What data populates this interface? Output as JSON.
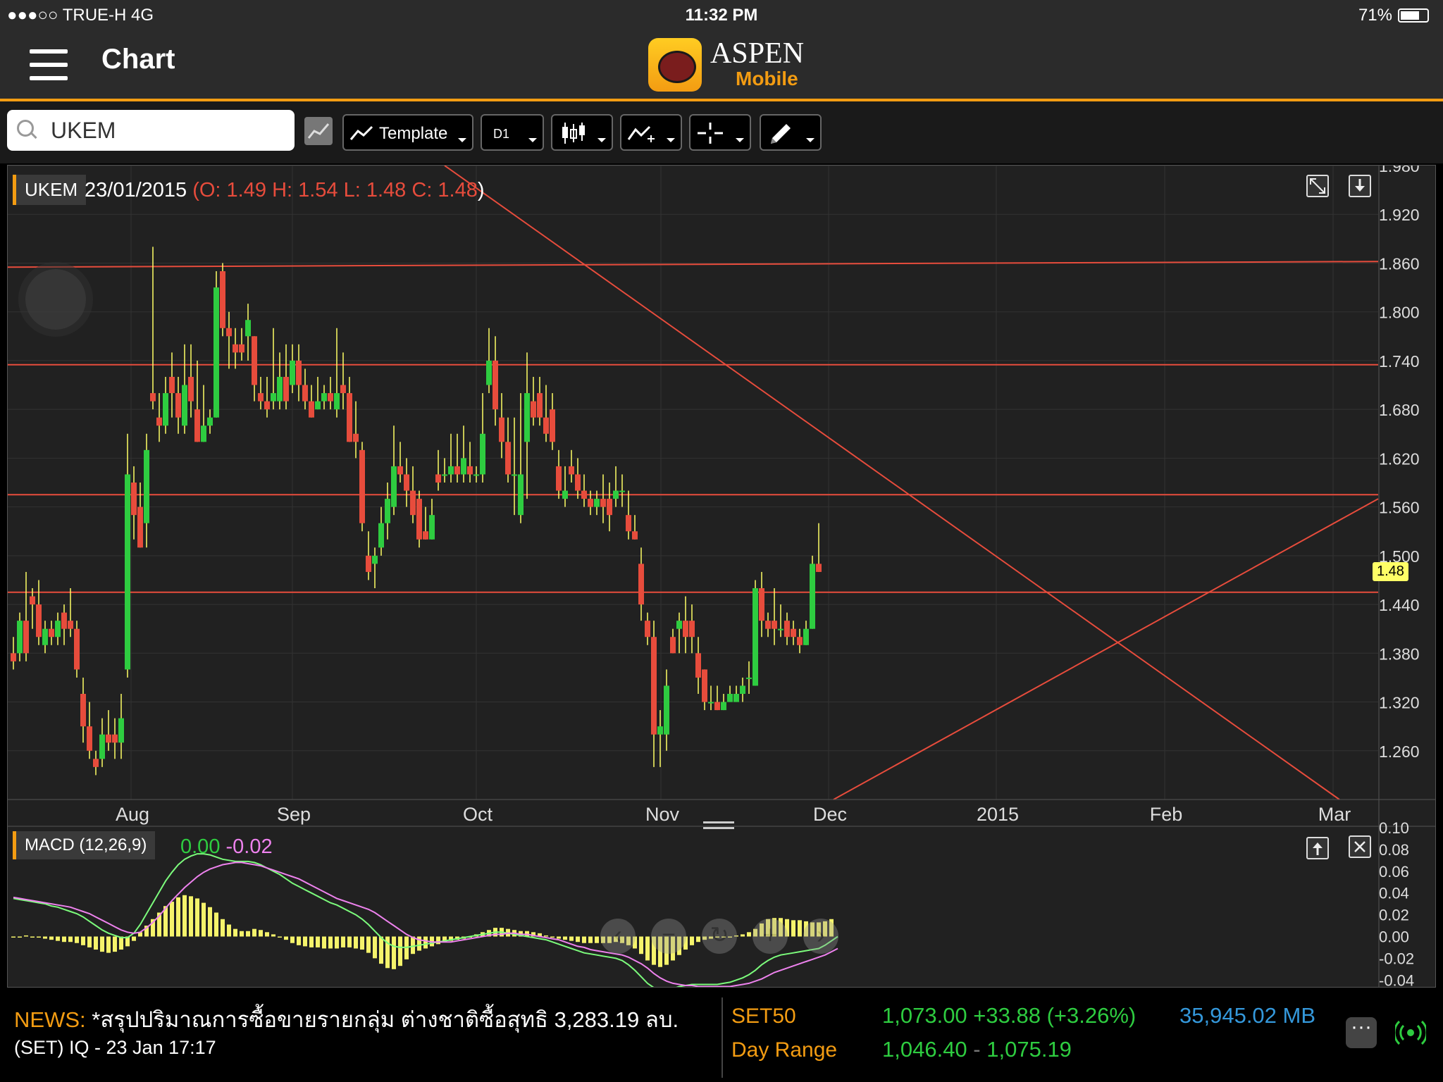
{
  "status": {
    "carrier": "●●●○○ TRUE-H   4G",
    "time": "11:32 PM",
    "battery": "71%",
    "battery_level": 0.71
  },
  "nav": {
    "title": "Chart",
    "brand_line1": "ASPEN",
    "brand_line2": "Mobile"
  },
  "toolbar": {
    "search_value": "UKEM",
    "template_label": "Template",
    "period_label": "D1"
  },
  "chart_header": {
    "symbol": "UKEM",
    "date": "23/01/2015",
    "open_prefix": "(O: 1.49",
    "high": "H: 1.54",
    "low": "L: 1.48",
    "close": "C: 1.48",
    "close_suffix": ")"
  },
  "last_price": "1.48",
  "macd": {
    "label": "MACD (12,26,9)",
    "value": "0.00",
    "signal": "-0.02"
  },
  "news": {
    "prefix": "NEWS:",
    "headline": "*สรุปปริมาณการซื้อขายรายกลุ่ม ต่างชาติซื้อสุทธิ 3,283.19 ลบ.",
    "source": "(SET)",
    "meta": "IQ - 23 Jan 17:17"
  },
  "index": {
    "name": "SET50",
    "value": "1,073.00 +33.88 (+3.26%)",
    "turnover": "35,945.02 MB",
    "range_label": "Day Range",
    "range_low": "1,046.40",
    "range_sep": "-",
    "range_high": "1,075.19"
  },
  "colors": {
    "up": "#2ecc40",
    "down": "#e74c3c",
    "accent": "#f39c12",
    "macd_hist": "#f5f36b",
    "macd_line": "#7CFC7C",
    "signal_line": "#ee82ee"
  },
  "chart_data": [
    {
      "type": "candlestick",
      "title": "UKEM",
      "x_ticks": [
        "Aug",
        "Sep",
        "Oct",
        "Nov",
        "Dec",
        "2015",
        "Feb",
        "Mar"
      ],
      "y_ticks": [
        "1.980",
        "1.920",
        "1.860",
        "1.800",
        "1.740",
        "1.680",
        "1.620",
        "1.560",
        "1.500",
        "1.440",
        "1.380",
        "1.320",
        "1.260"
      ],
      "ylim": [
        1.2,
        1.98
      ],
      "horizontal_lines": [
        1.855,
        1.735,
        1.575,
        1.455
      ],
      "trendlines": [
        {
          "name": "down",
          "from": [
            -0.0,
            1.98
          ],
          "to": [
            1.0,
            1.2
          ]
        },
        {
          "name": "up",
          "from": [
            0.6,
            1.2
          ],
          "to": [
            1.0,
            1.57
          ]
        }
      ],
      "candles": [
        [
          1.38,
          1.37,
          1.4,
          1.36
        ],
        [
          1.38,
          1.42,
          1.43,
          1.37
        ],
        [
          1.42,
          1.38,
          1.48,
          1.37
        ],
        [
          1.45,
          1.44,
          1.46,
          1.41
        ],
        [
          1.44,
          1.4,
          1.47,
          1.39
        ],
        [
          1.39,
          1.41,
          1.42,
          1.38
        ],
        [
          1.41,
          1.4,
          1.42,
          1.39
        ],
        [
          1.4,
          1.42,
          1.43,
          1.39
        ],
        [
          1.43,
          1.41,
          1.44,
          1.39
        ],
        [
          1.42,
          1.41,
          1.46,
          1.4
        ],
        [
          1.41,
          1.36,
          1.42,
          1.35
        ],
        [
          1.33,
          1.29,
          1.35,
          1.27
        ],
        [
          1.29,
          1.26,
          1.32,
          1.25
        ],
        [
          1.25,
          1.24,
          1.26,
          1.23
        ],
        [
          1.25,
          1.28,
          1.3,
          1.24
        ],
        [
          1.28,
          1.27,
          1.31,
          1.26
        ],
        [
          1.28,
          1.27,
          1.3,
          1.25
        ],
        [
          1.27,
          1.3,
          1.33,
          1.25
        ],
        [
          1.36,
          1.6,
          1.65,
          1.35
        ],
        [
          1.59,
          1.55,
          1.61,
          1.52
        ],
        [
          1.56,
          1.51,
          1.59,
          1.51
        ],
        [
          1.54,
          1.63,
          1.65,
          1.51
        ],
        [
          1.7,
          1.69,
          1.88,
          1.68
        ],
        [
          1.67,
          1.66,
          1.7,
          1.64
        ],
        [
          1.66,
          1.7,
          1.72,
          1.65
        ],
        [
          1.72,
          1.7,
          1.75,
          1.67
        ],
        [
          1.7,
          1.67,
          1.72,
          1.65
        ],
        [
          1.66,
          1.71,
          1.76,
          1.65
        ],
        [
          1.72,
          1.69,
          1.76,
          1.67
        ],
        [
          1.68,
          1.64,
          1.74,
          1.64
        ],
        [
          1.64,
          1.66,
          1.71,
          1.64
        ],
        [
          1.66,
          1.67,
          1.68,
          1.65
        ],
        [
          1.67,
          1.83,
          1.85,
          1.67
        ],
        [
          1.85,
          1.78,
          1.86,
          1.77
        ],
        [
          1.78,
          1.77,
          1.8,
          1.73
        ],
        [
          1.76,
          1.75,
          1.78,
          1.73
        ],
        [
          1.76,
          1.75,
          1.78,
          1.74
        ],
        [
          1.77,
          1.79,
          1.81,
          1.74
        ],
        [
          1.77,
          1.71,
          1.77,
          1.69
        ],
        [
          1.7,
          1.69,
          1.72,
          1.68
        ],
        [
          1.69,
          1.68,
          1.72,
          1.67
        ],
        [
          1.69,
          1.7,
          1.78,
          1.68
        ],
        [
          1.69,
          1.72,
          1.75,
          1.68
        ],
        [
          1.72,
          1.69,
          1.76,
          1.68
        ],
        [
          1.71,
          1.74,
          1.76,
          1.7
        ],
        [
          1.74,
          1.71,
          1.76,
          1.69
        ],
        [
          1.71,
          1.69,
          1.73,
          1.68
        ],
        [
          1.69,
          1.67,
          1.71,
          1.67
        ],
        [
          1.68,
          1.69,
          1.72,
          1.68
        ],
        [
          1.69,
          1.7,
          1.71,
          1.68
        ],
        [
          1.7,
          1.69,
          1.72,
          1.68
        ],
        [
          1.68,
          1.7,
          1.78,
          1.67
        ],
        [
          1.71,
          1.7,
          1.75,
          1.68
        ],
        [
          1.7,
          1.64,
          1.72,
          1.64
        ],
        [
          1.65,
          1.64,
          1.69,
          1.62
        ],
        [
          1.63,
          1.54,
          1.64,
          1.53
        ],
        [
          1.5,
          1.48,
          1.53,
          1.47
        ],
        [
          1.49,
          1.5,
          1.51,
          1.46
        ],
        [
          1.51,
          1.54,
          1.56,
          1.5
        ],
        [
          1.54,
          1.57,
          1.59,
          1.52
        ],
        [
          1.56,
          1.61,
          1.66,
          1.55
        ],
        [
          1.61,
          1.6,
          1.64,
          1.59
        ],
        [
          1.6,
          1.58,
          1.62,
          1.56
        ],
        [
          1.58,
          1.55,
          1.61,
          1.54
        ],
        [
          1.57,
          1.52,
          1.58,
          1.51
        ],
        [
          1.53,
          1.52,
          1.56,
          1.52
        ],
        [
          1.52,
          1.55,
          1.57,
          1.52
        ],
        [
          1.6,
          1.59,
          1.63,
          1.58
        ],
        [
          1.6,
          1.6,
          1.62,
          1.59
        ],
        [
          1.6,
          1.61,
          1.65,
          1.59
        ],
        [
          1.61,
          1.6,
          1.65,
          1.59
        ],
        [
          1.6,
          1.62,
          1.66,
          1.59
        ],
        [
          1.61,
          1.6,
          1.64,
          1.59
        ],
        [
          1.6,
          1.6,
          1.61,
          1.59
        ],
        [
          1.6,
          1.65,
          1.7,
          1.59
        ],
        [
          1.71,
          1.74,
          1.78,
          1.7
        ],
        [
          1.74,
          1.68,
          1.77,
          1.66
        ],
        [
          1.67,
          1.64,
          1.7,
          1.62
        ],
        [
          1.64,
          1.6,
          1.67,
          1.59
        ],
        [
          1.6,
          1.6,
          1.67,
          1.55
        ],
        [
          1.55,
          1.6,
          1.7,
          1.54
        ],
        [
          1.64,
          1.7,
          1.75,
          1.57
        ],
        [
          1.69,
          1.67,
          1.72,
          1.66
        ],
        [
          1.7,
          1.67,
          1.72,
          1.66
        ],
        [
          1.67,
          1.65,
          1.71,
          1.64
        ],
        [
          1.68,
          1.64,
          1.7,
          1.63
        ],
        [
          1.61,
          1.58,
          1.63,
          1.57
        ],
        [
          1.57,
          1.58,
          1.61,
          1.56
        ],
        [
          1.61,
          1.6,
          1.63,
          1.59
        ],
        [
          1.6,
          1.58,
          1.62,
          1.57
        ],
        [
          1.58,
          1.57,
          1.6,
          1.56
        ],
        [
          1.57,
          1.56,
          1.58,
          1.55
        ],
        [
          1.56,
          1.57,
          1.58,
          1.55
        ],
        [
          1.57,
          1.56,
          1.6,
          1.54
        ],
        [
          1.57,
          1.55,
          1.59,
          1.53
        ],
        [
          1.57,
          1.58,
          1.61,
          1.56
        ],
        [
          1.58,
          1.58,
          1.6,
          1.56
        ],
        [
          1.55,
          1.53,
          1.58,
          1.52
        ],
        [
          1.53,
          1.52,
          1.55,
          1.52
        ],
        [
          1.49,
          1.44,
          1.51,
          1.42
        ],
        [
          1.42,
          1.4,
          1.43,
          1.39
        ],
        [
          1.4,
          1.28,
          1.42,
          1.24
        ],
        [
          1.28,
          1.29,
          1.31,
          1.24
        ],
        [
          1.28,
          1.34,
          1.36,
          1.26
        ],
        [
          1.4,
          1.38,
          1.41,
          1.38
        ],
        [
          1.41,
          1.42,
          1.43,
          1.38
        ],
        [
          1.42,
          1.4,
          1.45,
          1.38
        ],
        [
          1.42,
          1.4,
          1.44,
          1.38
        ],
        [
          1.38,
          1.35,
          1.4,
          1.33
        ],
        [
          1.36,
          1.32,
          1.36,
          1.31
        ],
        [
          1.32,
          1.32,
          1.34,
          1.31
        ],
        [
          1.32,
          1.31,
          1.34,
          1.31
        ],
        [
          1.31,
          1.32,
          1.33,
          1.31
        ],
        [
          1.32,
          1.33,
          1.34,
          1.32
        ],
        [
          1.32,
          1.33,
          1.34,
          1.32
        ],
        [
          1.33,
          1.34,
          1.35,
          1.32
        ],
        [
          1.35,
          1.35,
          1.37,
          1.33
        ],
        [
          1.34,
          1.46,
          1.47,
          1.34
        ],
        [
          1.46,
          1.42,
          1.48,
          1.4
        ],
        [
          1.42,
          1.41,
          1.43,
          1.4
        ],
        [
          1.42,
          1.41,
          1.46,
          1.39
        ],
        [
          1.41,
          1.41,
          1.44,
          1.4
        ],
        [
          1.42,
          1.4,
          1.43,
          1.39
        ],
        [
          1.41,
          1.4,
          1.42,
          1.39
        ],
        [
          1.4,
          1.39,
          1.41,
          1.38
        ],
        [
          1.39,
          1.41,
          1.42,
          1.39
        ],
        [
          1.41,
          1.49,
          1.5,
          1.41
        ],
        [
          1.49,
          1.48,
          1.54,
          1.48
        ]
      ]
    },
    {
      "type": "bar",
      "title": "MACD (12,26,9)",
      "y_ticks": [
        "0.10",
        "0.08",
        "0.06",
        "0.04",
        "0.02",
        "0.00",
        "-0.02",
        "-0.04"
      ],
      "ylim": [
        -0.045,
        0.1
      ],
      "histogram": [
        0,
        0,
        0.001,
        0,
        -0.001,
        -0.002,
        -0.003,
        -0.004,
        -0.005,
        -0.005,
        -0.006,
        -0.008,
        -0.01,
        -0.012,
        -0.014,
        -0.015,
        -0.014,
        -0.012,
        -0.009,
        -0.004,
        0.004,
        0.01,
        0.016,
        0.022,
        0.028,
        0.032,
        0.036,
        0.038,
        0.037,
        0.035,
        0.031,
        0.027,
        0.022,
        0.016,
        0.011,
        0.007,
        0.005,
        0.005,
        0.007,
        0.006,
        0.004,
        0.002,
        0,
        -0.003,
        -0.006,
        -0.008,
        -0.009,
        -0.01,
        -0.01,
        -0.011,
        -0.011,
        -0.011,
        -0.01,
        -0.01,
        -0.011,
        -0.012,
        -0.015,
        -0.02,
        -0.025,
        -0.029,
        -0.03,
        -0.027,
        -0.021,
        -0.016,
        -0.013,
        -0.011,
        -0.009,
        -0.007,
        -0.005,
        -0.004,
        -0.003,
        -0.002,
        0,
        0.002,
        0.004,
        0.006,
        0.008,
        0.008,
        0.007,
        0.006,
        0.005,
        0.005,
        0.004,
        0.003,
        0.001,
        -0.001,
        -0.002,
        -0.003,
        -0.004,
        -0.005,
        -0.006,
        -0.006,
        -0.006,
        -0.006,
        -0.006,
        -0.005,
        -0.006,
        -0.008,
        -0.011,
        -0.016,
        -0.022,
        -0.026,
        -0.028,
        -0.026,
        -0.022,
        -0.017,
        -0.012,
        -0.008,
        -0.005,
        -0.003,
        -0.002,
        -0.001,
        -0.001,
        0,
        0.001,
        0.002,
        0.004,
        0.007,
        0.012,
        0.016,
        0.017,
        0.017,
        0.016,
        0.015,
        0.015,
        0.014,
        0.013,
        0.013,
        0.014,
        0.016
      ],
      "macd_line": [
        0.035,
        0.034,
        0.033,
        0.032,
        0.031,
        0.03,
        0.028,
        0.027,
        0.025,
        0.023,
        0.021,
        0.018,
        0.014,
        0.01,
        0.006,
        0.003,
        0.001,
        -0.001,
        -0.001,
        0.003,
        0.011,
        0.021,
        0.031,
        0.041,
        0.051,
        0.059,
        0.066,
        0.071,
        0.074,
        0.076,
        0.076,
        0.075,
        0.073,
        0.071,
        0.07,
        0.069,
        0.069,
        0.069,
        0.068,
        0.066,
        0.063,
        0.06,
        0.057,
        0.053,
        0.049,
        0.046,
        0.043,
        0.04,
        0.037,
        0.034,
        0.031,
        0.029,
        0.026,
        0.023,
        0.02,
        0.016,
        0.011,
        0.005,
        -0.001,
        -0.006,
        -0.009,
        -0.01,
        -0.01,
        -0.009,
        -0.008,
        -0.007,
        -0.006,
        -0.005,
        -0.004,
        -0.003,
        -0.002,
        -0.001,
        0,
        0.001,
        0.002,
        0.003,
        0.004,
        0.004,
        0.003,
        0.002,
        0.001,
        0,
        -0.001,
        -0.002,
        -0.003,
        -0.005,
        -0.007,
        -0.009,
        -0.011,
        -0.013,
        -0.015,
        -0.016,
        -0.017,
        -0.018,
        -0.019,
        -0.02,
        -0.022,
        -0.026,
        -0.031,
        -0.037,
        -0.043,
        -0.047,
        -0.049,
        -0.049,
        -0.048,
        -0.046,
        -0.045,
        -0.044,
        -0.044,
        -0.044,
        -0.044,
        -0.044,
        -0.043,
        -0.042,
        -0.04,
        -0.038,
        -0.035,
        -0.031,
        -0.026,
        -0.022,
        -0.019,
        -0.017,
        -0.016,
        -0.015,
        -0.014,
        -0.013,
        -0.012,
        -0.011,
        -0.008,
        -0.004,
        0
      ],
      "signal_line": [
        0.036,
        0.035,
        0.034,
        0.033,
        0.032,
        0.031,
        0.03,
        0.029,
        0.028,
        0.027,
        0.025,
        0.023,
        0.021,
        0.018,
        0.015,
        0.012,
        0.009,
        0.006,
        0.004,
        0.003,
        0.004,
        0.008,
        0.013,
        0.019,
        0.026,
        0.033,
        0.039,
        0.045,
        0.05,
        0.055,
        0.059,
        0.062,
        0.064,
        0.066,
        0.067,
        0.068,
        0.068,
        0.067,
        0.066,
        0.065,
        0.063,
        0.061,
        0.059,
        0.057,
        0.055,
        0.053,
        0.05,
        0.047,
        0.044,
        0.041,
        0.038,
        0.035,
        0.033,
        0.031,
        0.029,
        0.027,
        0.025,
        0.022,
        0.018,
        0.014,
        0.01,
        0.006,
        0.002,
        -0.001,
        -0.003,
        -0.004,
        -0.005,
        -0.005,
        -0.005,
        -0.005,
        -0.004,
        -0.003,
        -0.002,
        -0.001,
        0,
        0.001,
        0.002,
        0.002,
        0.003,
        0.003,
        0.002,
        0.002,
        0.001,
        0,
        -0.001,
        -0.002,
        -0.003,
        -0.005,
        -0.007,
        -0.009,
        -0.01,
        -0.012,
        -0.013,
        -0.014,
        -0.015,
        -0.016,
        -0.017,
        -0.019,
        -0.022,
        -0.025,
        -0.029,
        -0.034,
        -0.038,
        -0.041,
        -0.043,
        -0.044,
        -0.045,
        -0.045,
        -0.046,
        -0.046,
        -0.046,
        -0.046,
        -0.046,
        -0.046,
        -0.045,
        -0.044,
        -0.043,
        -0.041,
        -0.039,
        -0.036,
        -0.033,
        -0.031,
        -0.029,
        -0.027,
        -0.025,
        -0.023,
        -0.021,
        -0.019,
        -0.017,
        -0.014,
        -0.011
      ]
    }
  ]
}
